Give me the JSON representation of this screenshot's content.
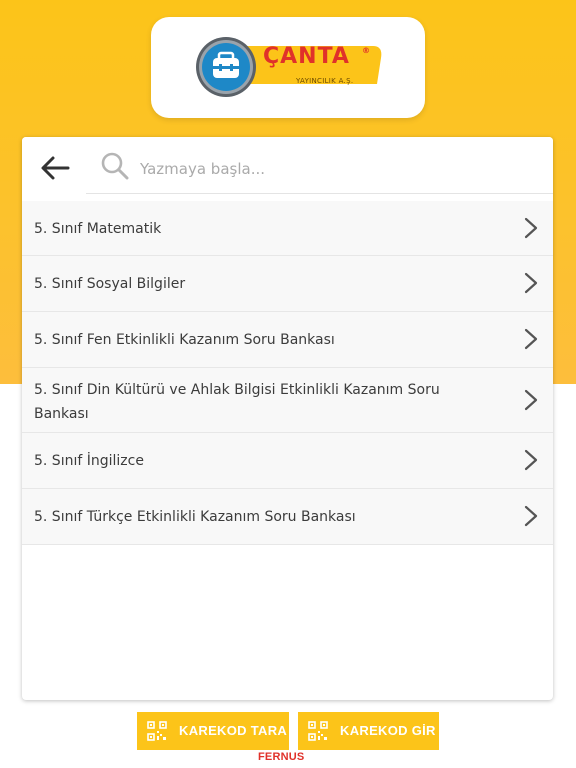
{
  "brand": {
    "logo_text": "ÇANTA",
    "logo_reg": "®",
    "logo_sub": "YAYINCILIK A.Ş.",
    "colors": {
      "primary_yellow": "#fcc419",
      "logo_red": "#e0312a",
      "icon_blue": "#1e88c7"
    }
  },
  "search": {
    "placeholder": "Yazmaya başla...",
    "value": ""
  },
  "list": {
    "items": [
      {
        "label": "5. Sınıf Matematik"
      },
      {
        "label": "5. Sınıf Sosyal Bilgiler"
      },
      {
        "label": "5. Sınıf Fen Etkinlikli Kazanım Soru Bankası"
      },
      {
        "label": "5. Sınıf Din Kültürü ve Ahlak Bilgisi Etkinlikli Kazanım Soru Bankası"
      },
      {
        "label": "5. Sınıf İngilizce"
      },
      {
        "label": "5. Sınıf Türkçe Etkinlikli Kazanım Soru Bankası"
      }
    ]
  },
  "footer": {
    "scan_label": "KAREKOD TARA",
    "enter_label": "KAREKOD GİR",
    "credit": "FERNUS"
  },
  "icons": {
    "back": "arrow-left-icon",
    "search": "search-icon",
    "chevron": "chevron-right-icon",
    "qr": "qr-code-icon",
    "bag": "briefcase-icon"
  }
}
